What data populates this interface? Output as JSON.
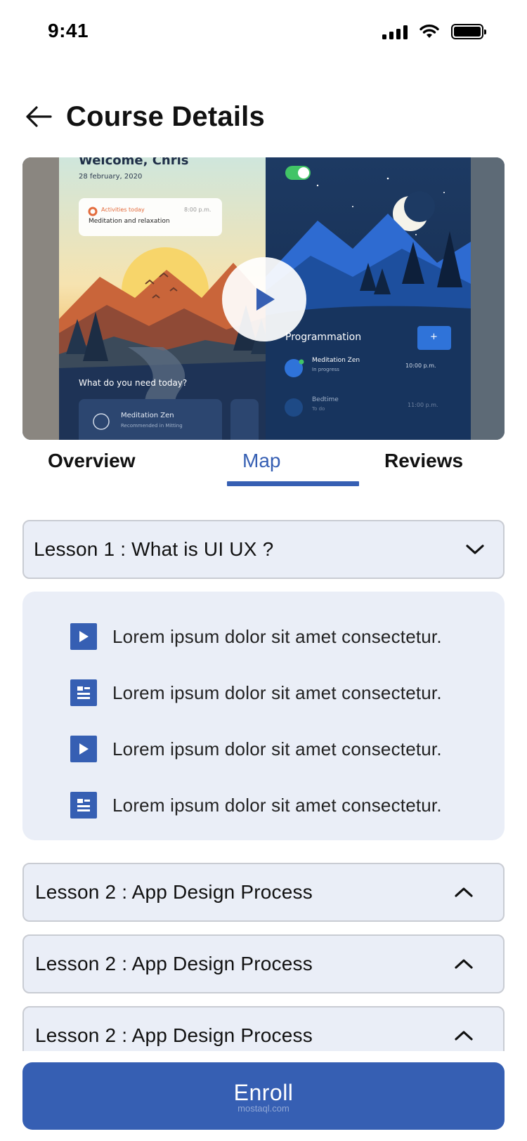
{
  "status_bar": {
    "time": "9:41"
  },
  "header": {
    "title": "Course Details"
  },
  "video": {
    "left_app": {
      "greeting": "Welcome, Chris",
      "date": "28 february, 2020",
      "activity_label": "Activities today",
      "activity_time": "8:00 p.m.",
      "activity_name": "Meditation and relaxation",
      "question": "What do you need today?",
      "card_title": "Meditation Zen",
      "card_sub": "Recommended in Mitting"
    },
    "right_app": {
      "section_title": "Programmation",
      "add_button": "+",
      "items": [
        {
          "title": "Meditation Zen",
          "status": "In progress",
          "time": "10:00 p.m."
        },
        {
          "title": "Bedtime",
          "status": "To do",
          "time": "11:00 p.m."
        }
      ]
    }
  },
  "tabs": [
    {
      "label": "Overview",
      "active": false
    },
    {
      "label": "Map",
      "active": true
    },
    {
      "label": "Reviews",
      "active": false
    }
  ],
  "lessons": [
    {
      "title": "Lesson 1 : What is UI UX ?",
      "expanded": true,
      "items": [
        {
          "type": "video",
          "icon": "play-icon",
          "text": "Lorem ipsum dolor sit amet consectetur."
        },
        {
          "type": "document",
          "icon": "document-icon",
          "text": "Lorem ipsum dolor sit amet consectetur."
        },
        {
          "type": "video",
          "icon": "play-icon",
          "text": "Lorem ipsum dolor sit amet consectetur."
        },
        {
          "type": "document",
          "icon": "document-icon",
          "text": "Lorem ipsum dolor sit amet consectetur."
        }
      ]
    },
    {
      "title": "Lesson 2 : App Design Process",
      "expanded": false
    },
    {
      "title": "Lesson 2 : App Design Process",
      "expanded": false
    },
    {
      "title": "Lesson 2 : App Design Process",
      "expanded": false
    }
  ],
  "enroll": {
    "label": "Enroll",
    "watermark": "mostaql.com"
  },
  "colors": {
    "accent": "#365fb3",
    "lesson_bg": "#eaeef7",
    "lesson_border": "#c9ccd3"
  }
}
